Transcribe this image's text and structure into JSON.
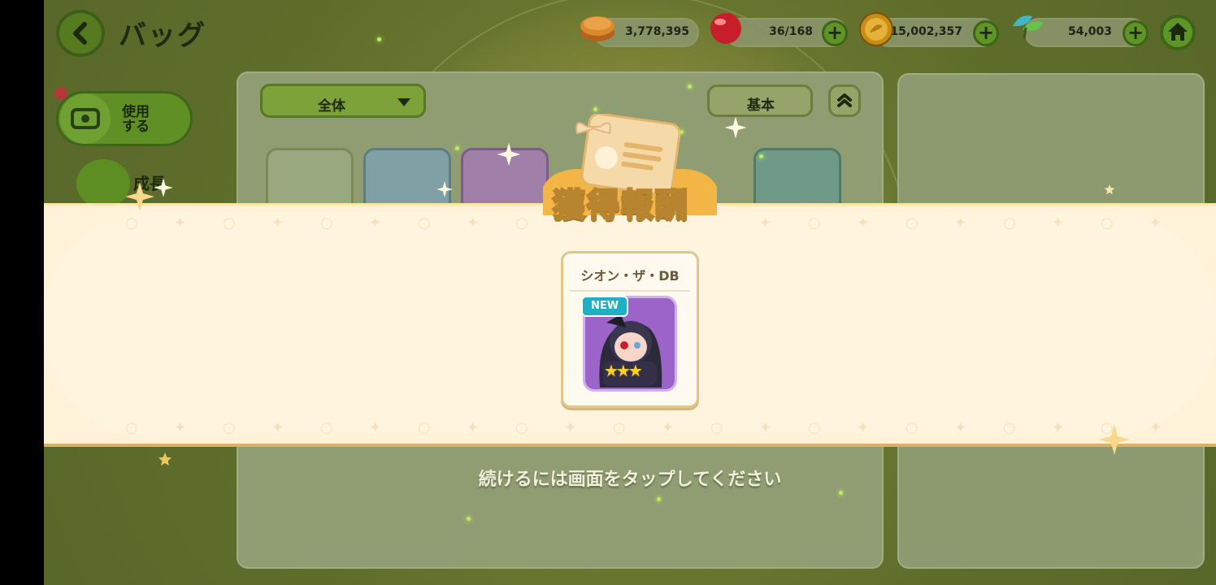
{
  "header": {
    "title": "バッグ",
    "resources": [
      {
        "name": "pancake",
        "value": "3,778,395",
        "has_plus": false
      },
      {
        "name": "jelly",
        "value": "36/168",
        "has_plus": true
      },
      {
        "name": "coin",
        "value": "15,002,357",
        "has_plus": true
      },
      {
        "name": "leaf",
        "value": "54,003",
        "has_plus": true
      }
    ]
  },
  "sidebar": {
    "use_label_line1": "使用",
    "use_label_line2": "する",
    "grow_label": "成長"
  },
  "bag": {
    "filter_selected": "全体",
    "sort_label": "基本"
  },
  "reward": {
    "title": "獲得報酬",
    "item_name": "シオン・ザ・DB",
    "badge": "NEW",
    "stars": "★★★"
  },
  "prompt": "続けるには画面をタップしてください",
  "colors": {
    "banner_bg": "#fff4dd",
    "accent_green": "#5f9527",
    "badge_cyan": "#1fb0c6",
    "portrait_purple": "#9c63c9"
  }
}
